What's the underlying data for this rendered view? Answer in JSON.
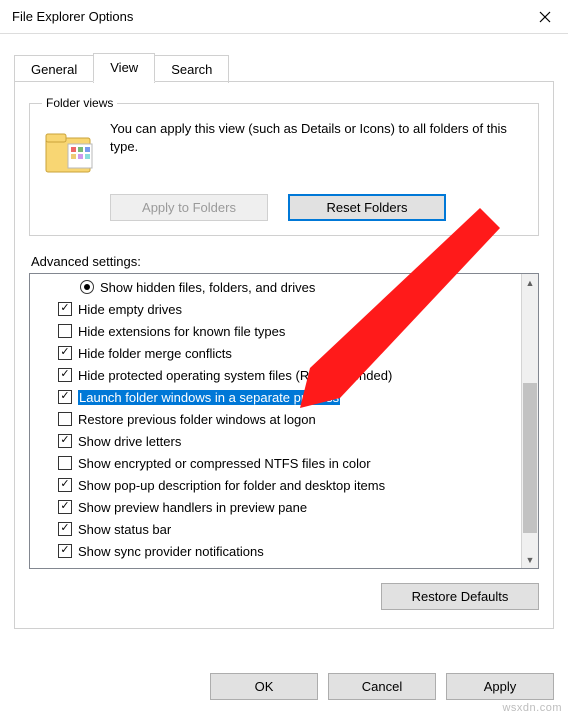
{
  "window": {
    "title": "File Explorer Options"
  },
  "tabs": {
    "general": "General",
    "view": "View",
    "search": "Search"
  },
  "folder_views": {
    "legend": "Folder views",
    "text": "You can apply this view (such as Details or Icons) to all folders of this type.",
    "apply_button": "Apply to Folders",
    "reset_button": "Reset Folders"
  },
  "advanced": {
    "label": "Advanced settings:",
    "items": [
      {
        "type": "radio",
        "checked": true,
        "label": "Show hidden files, folders, and drives"
      },
      {
        "type": "checkbox",
        "checked": true,
        "label": "Hide empty drives"
      },
      {
        "type": "checkbox",
        "checked": false,
        "label": "Hide extensions for known file types"
      },
      {
        "type": "checkbox",
        "checked": true,
        "label": "Hide folder merge conflicts"
      },
      {
        "type": "checkbox",
        "checked": true,
        "label": "Hide protected operating system files (Recommended)"
      },
      {
        "type": "checkbox",
        "checked": true,
        "label": "Launch folder windows in a separate process",
        "highlight": true
      },
      {
        "type": "checkbox",
        "checked": false,
        "label": "Restore previous folder windows at logon"
      },
      {
        "type": "checkbox",
        "checked": true,
        "label": "Show drive letters"
      },
      {
        "type": "checkbox",
        "checked": false,
        "label": "Show encrypted or compressed NTFS files in color"
      },
      {
        "type": "checkbox",
        "checked": true,
        "label": "Show pop-up description for folder and desktop items"
      },
      {
        "type": "checkbox",
        "checked": true,
        "label": "Show preview handlers in preview pane"
      },
      {
        "type": "checkbox",
        "checked": true,
        "label": "Show status bar"
      },
      {
        "type": "checkbox",
        "checked": true,
        "label": "Show sync provider notifications"
      }
    ],
    "restore_button": "Restore Defaults"
  },
  "buttons": {
    "ok": "OK",
    "cancel": "Cancel",
    "apply": "Apply"
  },
  "watermark": "wsxdn.com"
}
